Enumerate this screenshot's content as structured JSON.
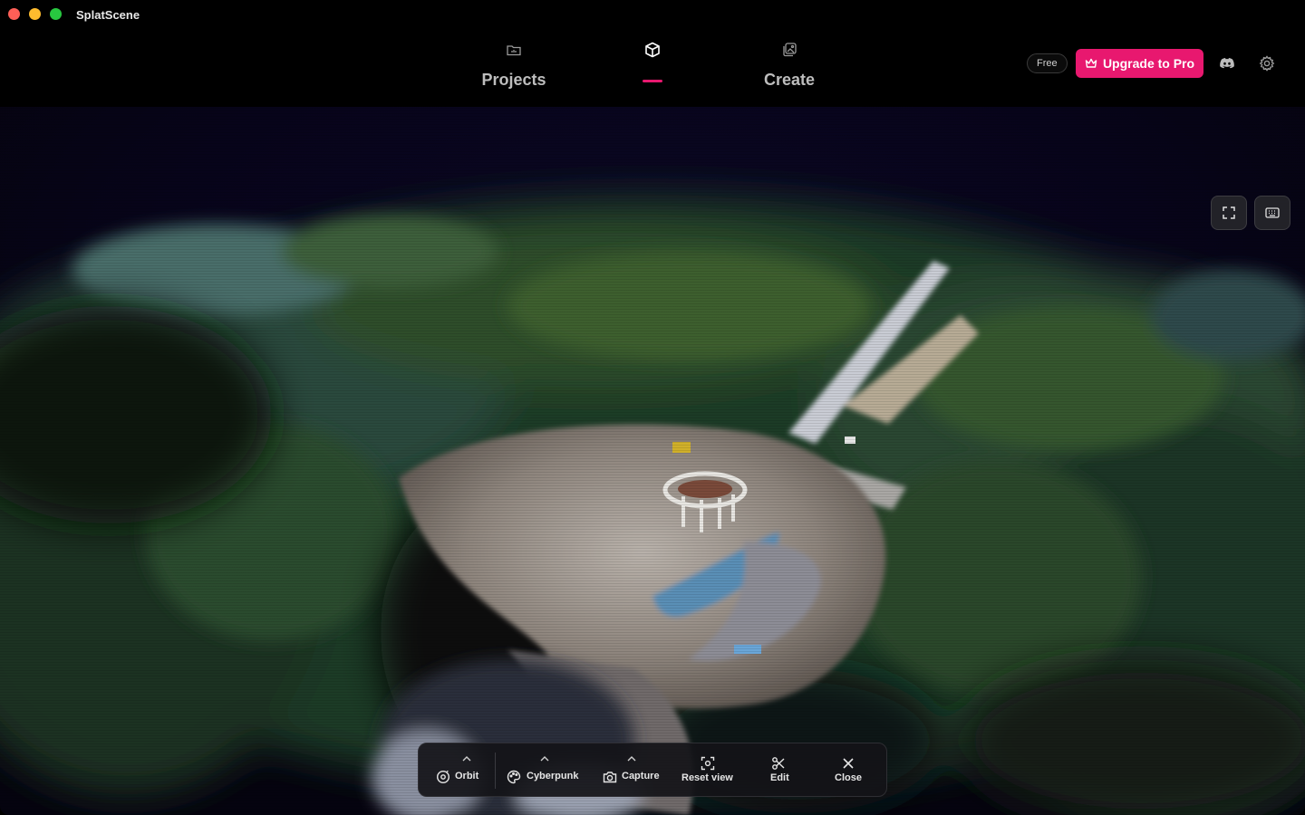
{
  "app": {
    "title": "SplatScene"
  },
  "nav": {
    "tabs": [
      {
        "label": "Projects",
        "icon": "folder-icon"
      },
      {
        "label": "",
        "icon": "cube-icon",
        "active": true
      },
      {
        "label": "Create",
        "icon": "images-icon"
      }
    ]
  },
  "header": {
    "plan_badge": "Free",
    "upgrade_label": "Upgrade to Pro",
    "accent_color": "#e8186f"
  },
  "toolbar": {
    "items": [
      {
        "label": "Orbit",
        "icon": "orbit-icon",
        "has_menu": true
      },
      {
        "label": "Cyberpunk",
        "icon": "palette-icon",
        "has_menu": true
      },
      {
        "label": "Capture",
        "icon": "camera-icon",
        "has_menu": true
      },
      {
        "label": "Reset view",
        "icon": "reset-view-icon",
        "has_menu": false
      },
      {
        "label": "Edit",
        "icon": "scissors-icon",
        "has_menu": false
      },
      {
        "label": "Close",
        "icon": "close-icon",
        "has_menu": false
      }
    ]
  }
}
